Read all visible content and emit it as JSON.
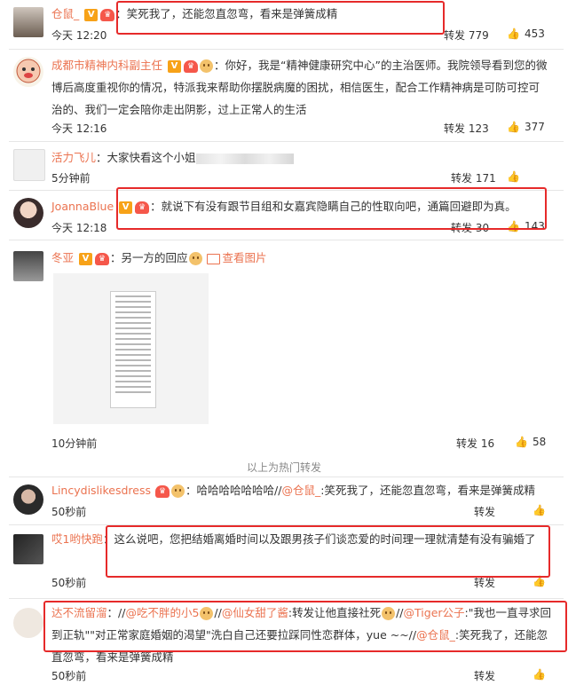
{
  "comments": [
    {
      "name": "仓鼠_",
      "text": "笑死我了，还能忽直忽弯，看来是弹簧成精",
      "time": "今天 12:20",
      "repost": "转发 779",
      "likes": "453"
    },
    {
      "name": "成都市精神内科副主任",
      "text": "你好，我是“精神健康研究中心”的主治医师。我院领导看到您的微博后高度重视你的情况，特派我来帮助你摆脱病魔的困扰，相信医生，配合工作精神病是可防可控可治的、我们一定会陪你走出阴影，过上正常人的生活",
      "time": "今天 12:16",
      "repost": "转发 123",
      "likes": "377"
    },
    {
      "name": "活力飞儿",
      "text": "大家快看这个小姐",
      "time": "5分钟前",
      "repost": "转发 171",
      "likes": ""
    },
    {
      "name": "JoannaBlue",
      "text": "就说下有没有跟节目组和女嘉宾隐瞒自己的性取向吧，通篇回避即为真。",
      "time": "今天 12:18",
      "repost": "转发 30",
      "likes": "143"
    },
    {
      "name": "冬亚",
      "text": "另一方的回应",
      "pic": "查看图片",
      "time": "10分钟前",
      "repost": "转发 16",
      "likes": "58"
    }
  ],
  "section_label": "以上为热门转发",
  "reposts": [
    {
      "name": "Lincydislikesdress",
      "text": "哈哈哈哈哈哈哈",
      "mention": "@仓鼠_",
      "tail": ":笑死我了，还能忽直忽弯，看来是弹簧成精",
      "time": "50秒前",
      "repost": "转发"
    },
    {
      "name": "哎1哟快跑",
      "text": "这么说吧，您把结婚离婚时间以及跟男孩子们谈恋爱的时间理一理就清楚有没有骗婚了",
      "time": "50秒前",
      "repost": "转发"
    },
    {
      "name": "达不流留溜",
      "p1": "//",
      "m1": "@吃不胖的小5",
      "p2": "//",
      "m2": "@仙女甜了酱",
      "p3": ":转发让他直接社死",
      "p4": "//",
      "m3": "@Tiger公子",
      "p5": ":\"我也一直寻求回到正轨\"\"对正常家庭婚姻的渴望\"洗白自己还要拉踩同性恋群体，yue ~~//",
      "m4": "@仓鼠_",
      "p6": ":笑死我了，还能忽直忽弯，看来是弹簧成精",
      "time": "50秒前",
      "repost": "转发"
    }
  ],
  "colors": {
    "accent": "#eb7350",
    "highlight_box": "#e62a2a"
  }
}
